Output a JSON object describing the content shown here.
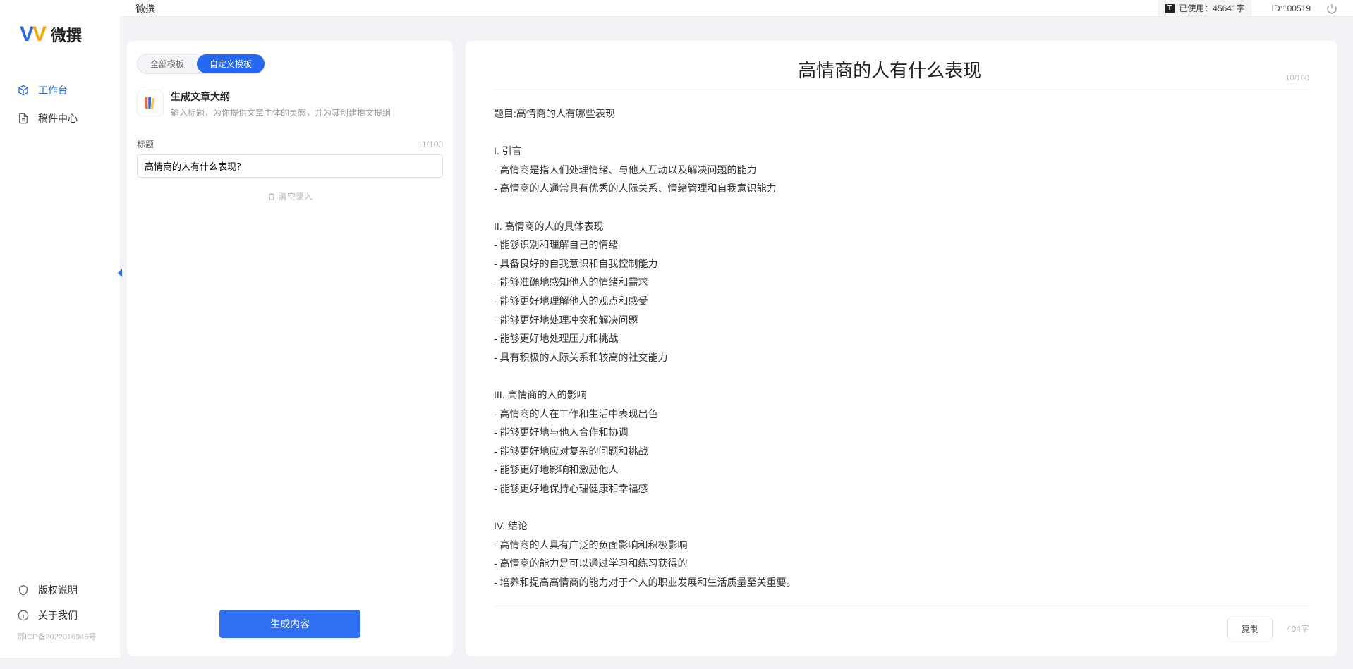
{
  "app": {
    "brand_text": "微撰",
    "topbar_title": "微撰",
    "usage_prefix": "已使用：",
    "usage_value": "45641字",
    "id_label": "ID:100519",
    "t_badge": "T"
  },
  "sidebar": {
    "items": [
      {
        "label": "工作台",
        "icon": "cube-icon",
        "active": true
      },
      {
        "label": "稿件中心",
        "icon": "doc-icon",
        "active": false
      }
    ],
    "bottom_items": [
      {
        "label": "版权说明",
        "icon": "shield-icon"
      },
      {
        "label": "关于我们",
        "icon": "info-icon"
      }
    ],
    "icp": "鄂ICP备2022016946号"
  },
  "templates": {
    "tabs": [
      {
        "label": "全部模板",
        "active": false
      },
      {
        "label": "自定义模板",
        "active": true
      }
    ],
    "card": {
      "title": "生成文章大纲",
      "desc": "输入标题，为你提供文章主体的灵感，并为其创建推文提纲"
    }
  },
  "form": {
    "title_label": "标题",
    "title_count": "11/100",
    "title_value": "高情商的人有什么表现？",
    "clear_label": "清空录入",
    "submit_label": "生成内容"
  },
  "document": {
    "title": "高情商的人有什么表现",
    "title_counter": "10/100",
    "body_lines": [
      "题目:高情商的人有哪些表现",
      "",
      "I. 引言",
      "- 高情商是指人们处理情绪、与他人互动以及解决问题的能力",
      "- 高情商的人通常具有优秀的人际关系、情绪管理和自我意识能力",
      "",
      "II. 高情商的人的具体表现",
      "- 能够识别和理解自己的情绪",
      "- 具备良好的自我意识和自我控制能力",
      "- 能够准确地感知他人的情绪和需求",
      "- 能够更好地理解他人的观点和感受",
      "- 能够更好地处理冲突和解决问题",
      "- 能够更好地处理压力和挑战",
      "- 具有积极的人际关系和较高的社交能力",
      "",
      "III. 高情商的人的影响",
      "- 高情商的人在工作和生活中表现出色",
      "- 能够更好地与他人合作和协调",
      "- 能够更好地应对复杂的问题和挑战",
      "- 能够更好地影响和激励他人",
      "- 能够更好地保持心理健康和幸福感",
      "",
      "IV. 结论",
      "- 高情商的人具有广泛的负面影响和积极影响",
      "- 高情商的能力是可以通过学习和练习获得的",
      "- 培养和提高高情商的能力对于个人的职业发展和生活质量至关重要。"
    ],
    "copy_label": "复制",
    "word_count": "404字"
  }
}
